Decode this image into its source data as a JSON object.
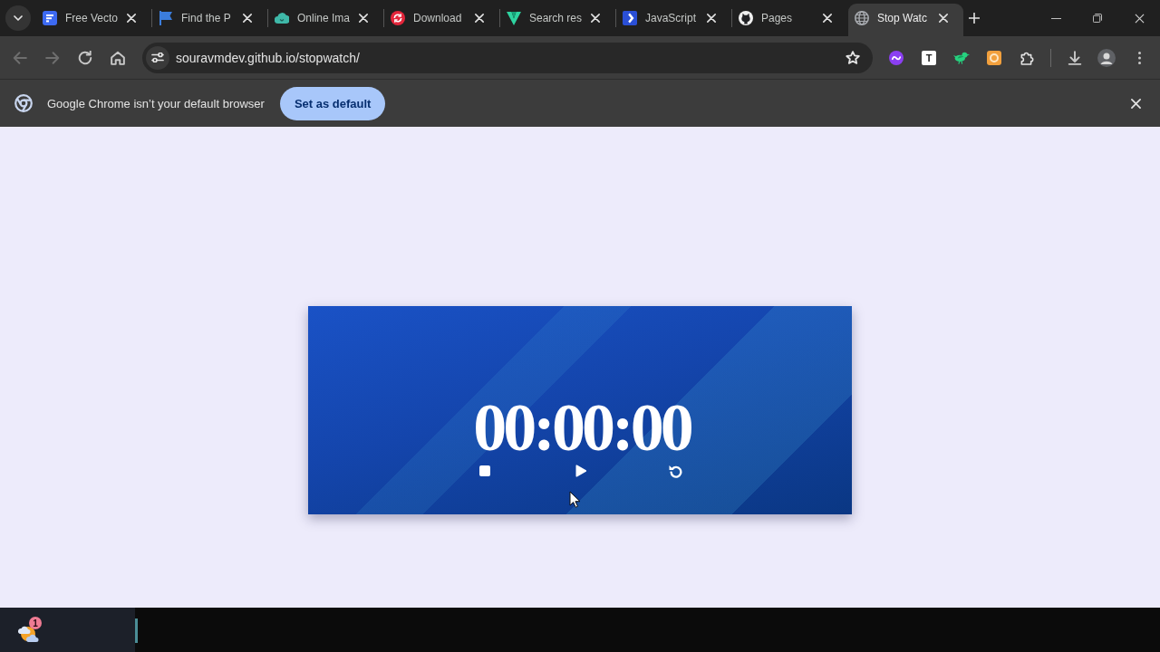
{
  "tabs": [
    {
      "kind": "document",
      "title": "Free Vecto",
      "selected": false
    },
    {
      "kind": "flag",
      "title": "Find the P",
      "selected": false
    },
    {
      "kind": "cloud",
      "title": "Online Ima",
      "selected": false
    },
    {
      "kind": "sync",
      "title": "Download",
      "selected": false
    },
    {
      "kind": "chevron",
      "title": "Search res",
      "selected": false
    },
    {
      "kind": "diamond",
      "title": "JavaScript",
      "selected": false
    },
    {
      "kind": "cat",
      "title": "Pages",
      "selected": false
    },
    {
      "kind": "globe",
      "title": "Stop Watc",
      "selected": true
    }
  ],
  "toolbar": {
    "nav_buttons": [
      {
        "kind": "back",
        "disabled": true
      },
      {
        "kind": "forward",
        "disabled": true
      },
      {
        "kind": "reload",
        "disabled": false
      },
      {
        "kind": "home",
        "disabled": false
      }
    ],
    "address_bar": {
      "url": "souravmdev.github.io/stopwatch/"
    },
    "extensions": [
      {
        "kind": "wave"
      },
      {
        "kind": "letter",
        "label": "T"
      },
      {
        "kind": "bird"
      },
      {
        "kind": "ring"
      },
      {
        "kind": "puzzle"
      }
    ]
  },
  "infobar": {
    "message": "Google Chrome isn’t your default browser",
    "button": "Set as default"
  },
  "stopwatch": {
    "time": "00:00:00",
    "controls": [
      {
        "kind": "stop"
      },
      {
        "kind": "play"
      },
      {
        "kind": "reset"
      }
    ]
  },
  "taskbar": {
    "weather_badge": "1"
  }
}
